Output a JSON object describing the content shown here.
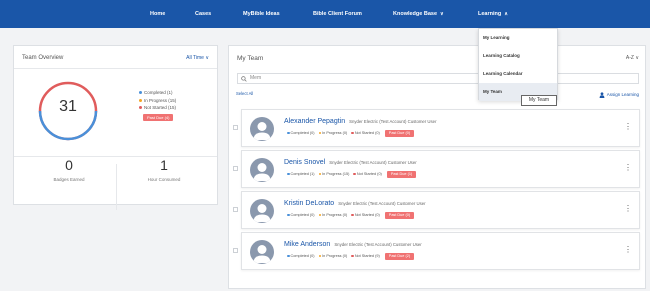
{
  "nav": {
    "items": [
      "Home",
      "Cases",
      "MyBible Ideas",
      "Bible Client Forum",
      "Knowledge Base",
      "Learning"
    ],
    "chevron": "∨",
    "up_chevron": "∧"
  },
  "learning_menu": {
    "items": [
      "My Learning",
      "Learning Catalog",
      "Learning Calendar",
      "My Team"
    ],
    "active": "My Team",
    "tooltip": "My Team"
  },
  "team_overview": {
    "title": "Team Overview",
    "filter": "All Time ∨",
    "total": "31",
    "legend": [
      "Completed (1)",
      "In Progress (15)",
      "Not Started (15)"
    ],
    "past_due": "Past Due (4)",
    "badges_count": "0",
    "badges_label": "Badges Earned",
    "hours_count": "1",
    "hours_label": "Hour Consumed",
    "colors": {
      "completed": "#4a90d9",
      "in_progress": "#f5a623",
      "not_started": "#e05c5c"
    }
  },
  "my_team": {
    "title": "My Team",
    "sort": "A-Z ∨",
    "search_value": "Mem",
    "select_all": "Select All",
    "assign_learning": "Assign Learning",
    "kebab": "⋮",
    "members": [
      {
        "name": "Alexander Pepagtin",
        "org": "Snyder Electric (Test Account) Customer User",
        "completed": "Completed (0)",
        "in_progress": "In Progress (0)",
        "not_started": "Not Started (0)",
        "past_due": "Past Due (0)"
      },
      {
        "name": "Denis Snovel",
        "org": "Snyder Electric (Test Account) Customer User",
        "completed": "Completed (1)",
        "in_progress": "In Progress (15)",
        "not_started": "Not Started (0)",
        "past_due": "Past Due (1)"
      },
      {
        "name": "Kristin DeLorato",
        "org": "Snyder Electric (Test Account) Customer User",
        "completed": "Completed (0)",
        "in_progress": "In Progress (0)",
        "not_started": "Not Started (0)",
        "past_due": "Past Due (0)"
      },
      {
        "name": "Mike Anderson",
        "org": "Snyder Electric (Test Account) Customer User",
        "completed": "Completed (0)",
        "in_progress": "In Progress (0)",
        "not_started": "Not Started (9)",
        "past_due": "Past Due (2)"
      }
    ]
  }
}
